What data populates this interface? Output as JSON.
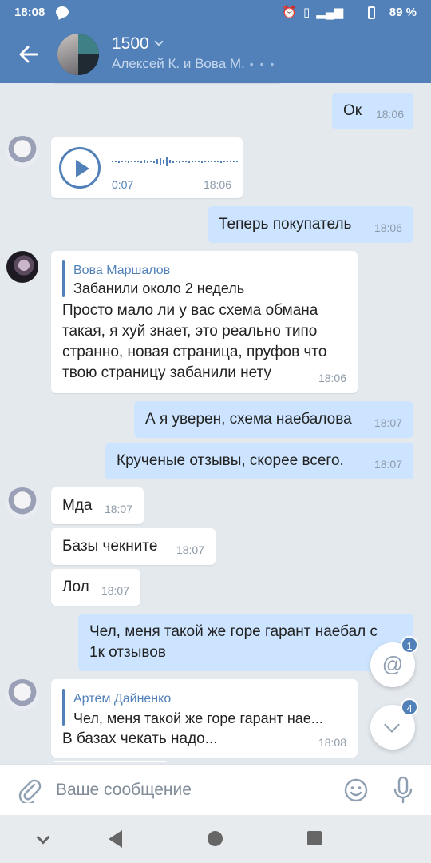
{
  "status_bar": {
    "time": "18:08",
    "battery": "89 %"
  },
  "header": {
    "title": "1500",
    "subtitle": "Алексей К. и Вова М.",
    "typing": "• • •"
  },
  "messages": [
    {
      "dir": "out",
      "text": "Ок",
      "time": "18:06"
    },
    {
      "dir": "in",
      "type": "voice",
      "duration": "0:07",
      "time": "18:06"
    },
    {
      "dir": "out",
      "text": "Теперь покупатель",
      "time": "18:06"
    },
    {
      "dir": "in",
      "reply": {
        "author": "Вова Маршалов",
        "text": "Забанили около 2 недель"
      },
      "text_lines": [
        "Просто мало ли у вас схема обмана",
        "такая, я хуй знает, это реально типо",
        "странно, новая страница, пруфов что",
        "твою страницу забанили нету"
      ],
      "time": "18:06"
    },
    {
      "dir": "out",
      "text": "А я уверен, схема наебалова",
      "time": "18:07"
    },
    {
      "dir": "out",
      "text": "Крученые отзывы, скорее всего.",
      "time": "18:07"
    },
    {
      "dir": "in",
      "text": "Мда",
      "time": "18:07"
    },
    {
      "dir": "in",
      "text": "Базы чекните",
      "time": "18:07"
    },
    {
      "dir": "in",
      "text": "Лол",
      "time": "18:07"
    },
    {
      "dir": "out",
      "text_lines": [
        "Чел, меня такой же горе гарант наебал с",
        "1к отзывов"
      ]
    },
    {
      "dir": "in",
      "reply": {
        "author": "Артём Дайненко",
        "text": "Чел, меня такой же горе гарант нае..."
      },
      "text": "В базах чекать надо...",
      "time": "18:08"
    }
  ],
  "fabs": {
    "mention_badge": "1",
    "scroll_badge": "4",
    "mention_symbol": "@"
  },
  "input": {
    "placeholder": "Ваше сообщение"
  }
}
